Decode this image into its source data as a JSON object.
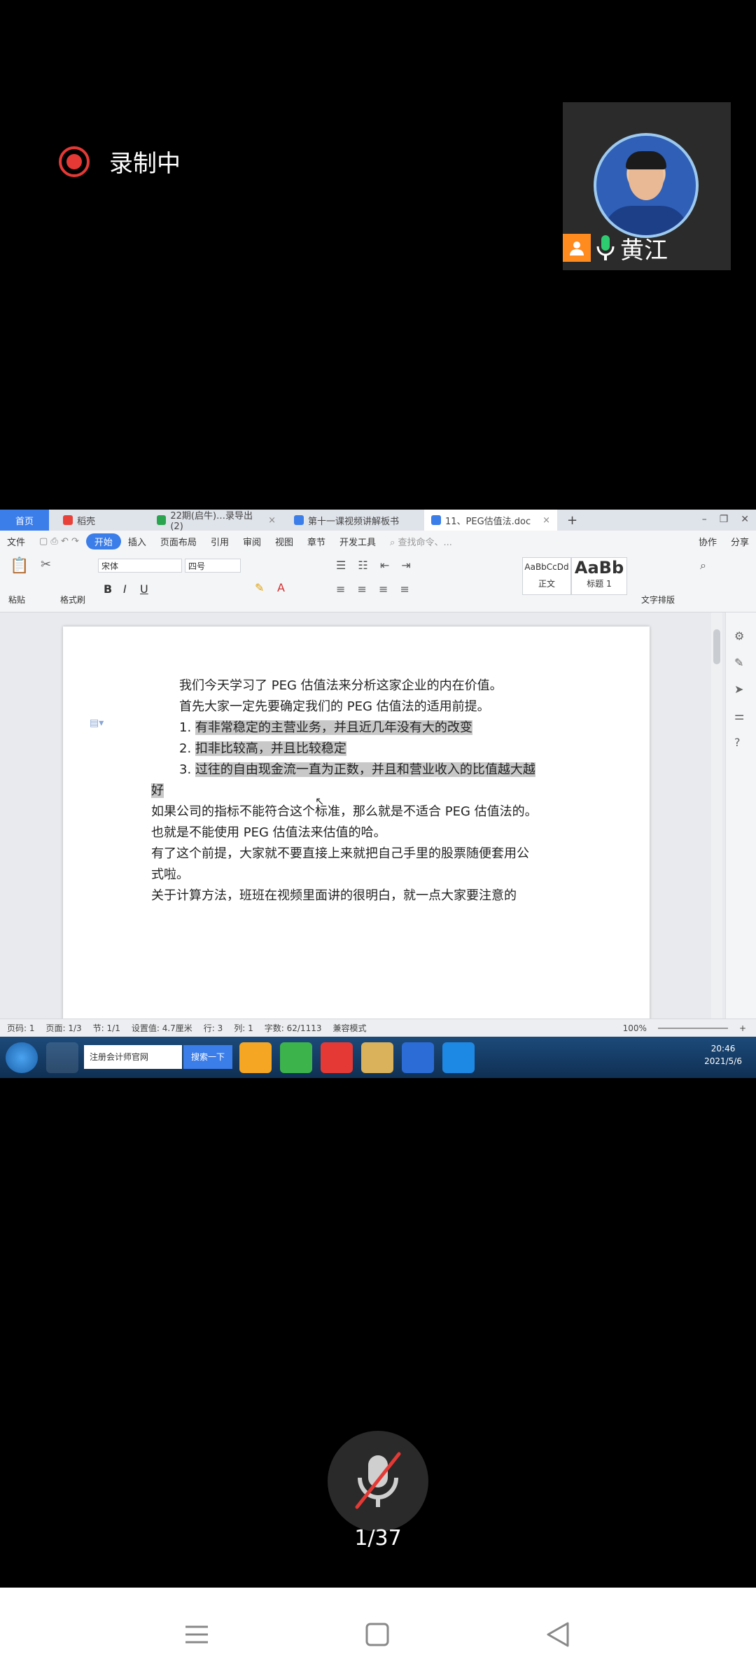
{
  "recording": {
    "label": "录制中",
    "color": "#e53935"
  },
  "participant": {
    "name": "黄江",
    "role_badge_color": "#ff8a1e",
    "mic_color": "#2ecc71"
  },
  "wps": {
    "tabs": [
      {
        "label": "首页"
      },
      {
        "label": "稻壳"
      },
      {
        "label": "22期(启牛)…录导出 (2)"
      },
      {
        "label": "第十一课视频讲解板书"
      },
      {
        "label": "11、PEG估值法.doc"
      }
    ],
    "new_tab": "+",
    "menu": [
      "文件",
      "开始",
      "插入",
      "页面布局",
      "引用",
      "审阅",
      "视图",
      "章节",
      "开发工具"
    ],
    "menu_active": "开始",
    "search_placeholder": "查找命令、...",
    "collab": "协作",
    "share": "分享",
    "ribbon": {
      "paste": "粘贴",
      "format_painter": "格式刷",
      "font_name": "宋体",
      "font_size": "四号",
      "style_normal_preview": "AaBbCcDd",
      "style_normal": "正文",
      "style_h1_preview": "AaBb",
      "style_h1": "标题 1",
      "text_layout": "文字排版"
    },
    "doc_lines": [
      "我们今天学习了 PEG 估值法来分析这家企业的内在价值。",
      "首先大家一定先要确定我们的 PEG 估值法的适用前提。",
      "有非常稳定的主营业务，并且近几年没有大的改变",
      "扣非比较高，并且比较稳定",
      "过往的自由现金流一直为正数，并且和营业收入的比值越大越",
      "好",
      "如果公司的指标不能符合这个标准，那么就是不适合 PEG 估值法的。",
      "也就是不能使用 PEG 估值法来估值的哈。",
      "有了这个前提，大家就不要直接上来就把自己手里的股票随便套用公",
      "式啦。",
      "关于计算方法，班班在视频里面讲的很明白，就一点大家要注意的"
    ],
    "list_numbers": [
      "1.",
      "2.",
      "3."
    ],
    "status": {
      "page_num": "页码: 1",
      "pages": "页面: 1/3",
      "section": "节: 1/1",
      "setting": "设置值: 4.7厘米",
      "row": "行: 3",
      "col": "列: 1",
      "words": "字数: 62/1113",
      "compat": "兼容模式",
      "zoom": "100%"
    },
    "taskbar": {
      "ie_label": "注册会计师官网",
      "search_button": "搜索一下",
      "time": "20:46",
      "date": "2021/5/6"
    }
  },
  "controls": {
    "page_counter": "1/37"
  }
}
